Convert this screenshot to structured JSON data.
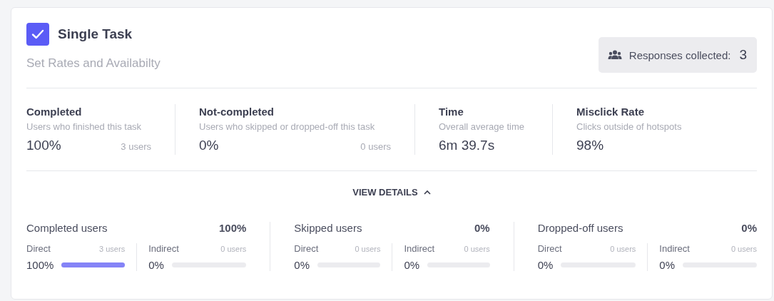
{
  "task": {
    "checked": true,
    "title": "Single Task",
    "subtitle": "Set Rates and Availabilty"
  },
  "responses": {
    "label": "Responses collected:",
    "count": "3"
  },
  "stats": [
    {
      "title": "Completed",
      "description": "Users who finished this task",
      "value": "100%",
      "users": "3 users"
    },
    {
      "title": "Not-completed",
      "description": "Users who skipped or dropped-off this task",
      "value": "0%",
      "users": "0 users"
    },
    {
      "title": "Time",
      "description": "Overall average time",
      "value": "6m 39.7s"
    },
    {
      "title": "Misclick Rate",
      "description": "Clicks outside of hotspots",
      "value": "98%"
    }
  ],
  "view_details": {
    "label": "VIEW DETAILS",
    "expanded": true
  },
  "groups": [
    {
      "title": "Completed users",
      "value": "100%",
      "items": [
        {
          "label": "Direct",
          "users": "3 users",
          "value": "100%",
          "level": 1
        },
        {
          "label": "Indirect",
          "users": "0 users",
          "value": "0%",
          "level": 0
        }
      ]
    },
    {
      "title": "Skipped users",
      "value": "0%",
      "items": [
        {
          "label": "Direct",
          "users": "0 users",
          "value": "0%",
          "level": 0
        },
        {
          "label": "Indirect",
          "users": "0 users",
          "value": "0%",
          "level": 0
        }
      ]
    },
    {
      "title": "Dropped-off users",
      "value": "0%",
      "items": [
        {
          "label": "Direct",
          "users": "0 users",
          "value": "0%",
          "level": 0
        },
        {
          "label": "Indirect",
          "users": "0 users",
          "value": "0%",
          "level": 0
        }
      ]
    }
  ]
}
